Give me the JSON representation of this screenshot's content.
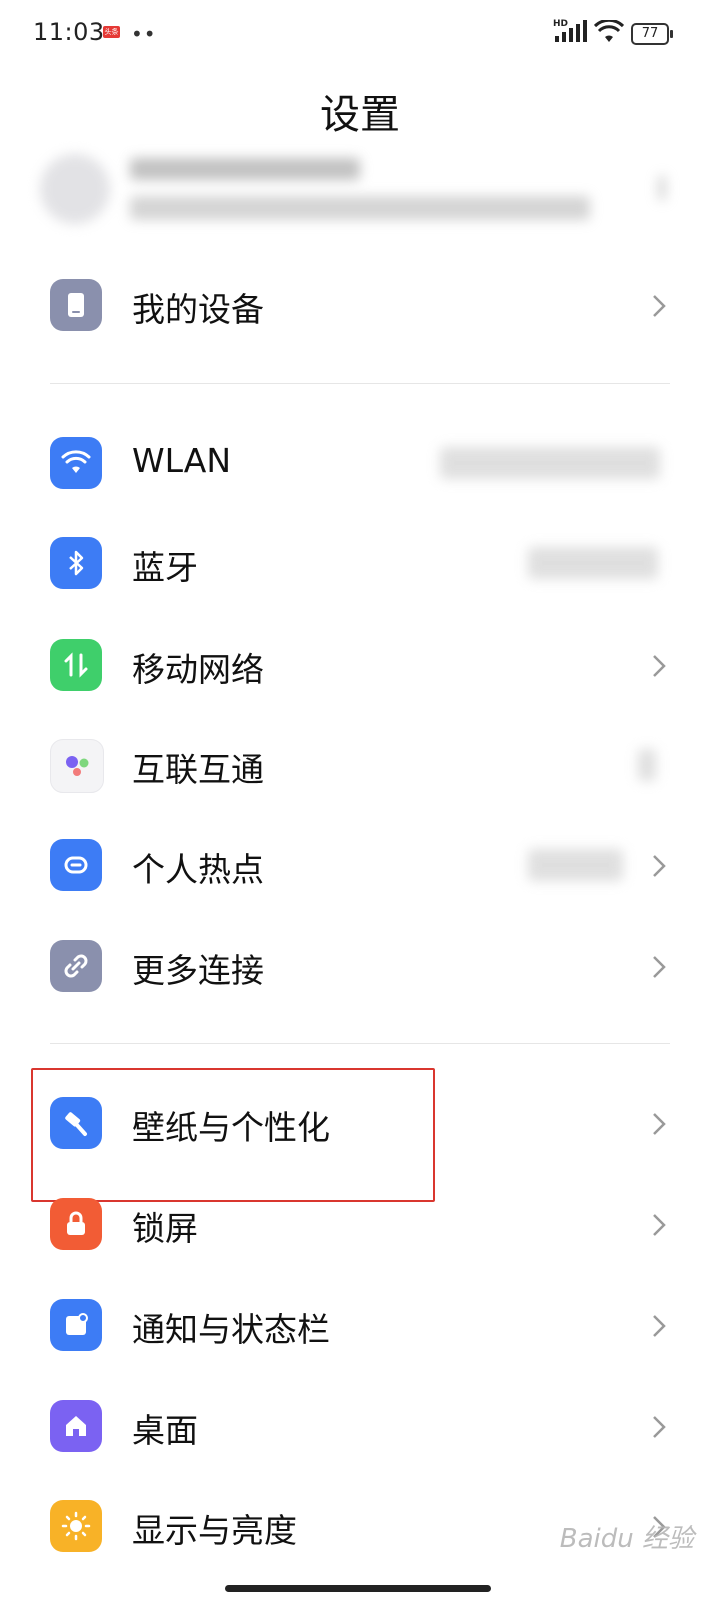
{
  "status_bar": {
    "time": "11:03",
    "battery": "77",
    "hd": "HD",
    "app_badge": "头条"
  },
  "header": {
    "title": "设置"
  },
  "sections": [
    {
      "items": [
        {
          "label": "我的设备",
          "icon": "phone-icon",
          "color": "#8a90ad"
        }
      ]
    },
    {
      "items": [
        {
          "label": "WLAN",
          "icon": "wifi-icon",
          "color": "#3d7cf5"
        },
        {
          "label": "蓝牙",
          "icon": "bluetooth-icon",
          "color": "#3d7cf5"
        },
        {
          "label": "移动网络",
          "icon": "mobile-data-icon",
          "color": "#3fcf6b"
        },
        {
          "label": "互联互通",
          "icon": "interconnect-icon",
          "color": "#f4f4f6"
        },
        {
          "label": "个人热点",
          "icon": "hotspot-icon",
          "color": "#3d7cf5"
        },
        {
          "label": "更多连接",
          "icon": "link-icon",
          "color": "#8a90ad"
        }
      ]
    },
    {
      "items": [
        {
          "label": "壁纸与个性化",
          "icon": "brush-icon",
          "color": "#3d7cf5"
        },
        {
          "label": "锁屏",
          "icon": "lock-icon",
          "color": "#f25c35"
        },
        {
          "label": "通知与状态栏",
          "icon": "notification-icon",
          "color": "#3d7cf5"
        },
        {
          "label": "桌面",
          "icon": "home-icon",
          "color": "#7b62f2"
        },
        {
          "label": "显示与亮度",
          "icon": "sun-icon",
          "color": "#f8b227"
        }
      ]
    }
  ],
  "highlight_color": "#d9362f",
  "watermark": "Baidu 经验"
}
